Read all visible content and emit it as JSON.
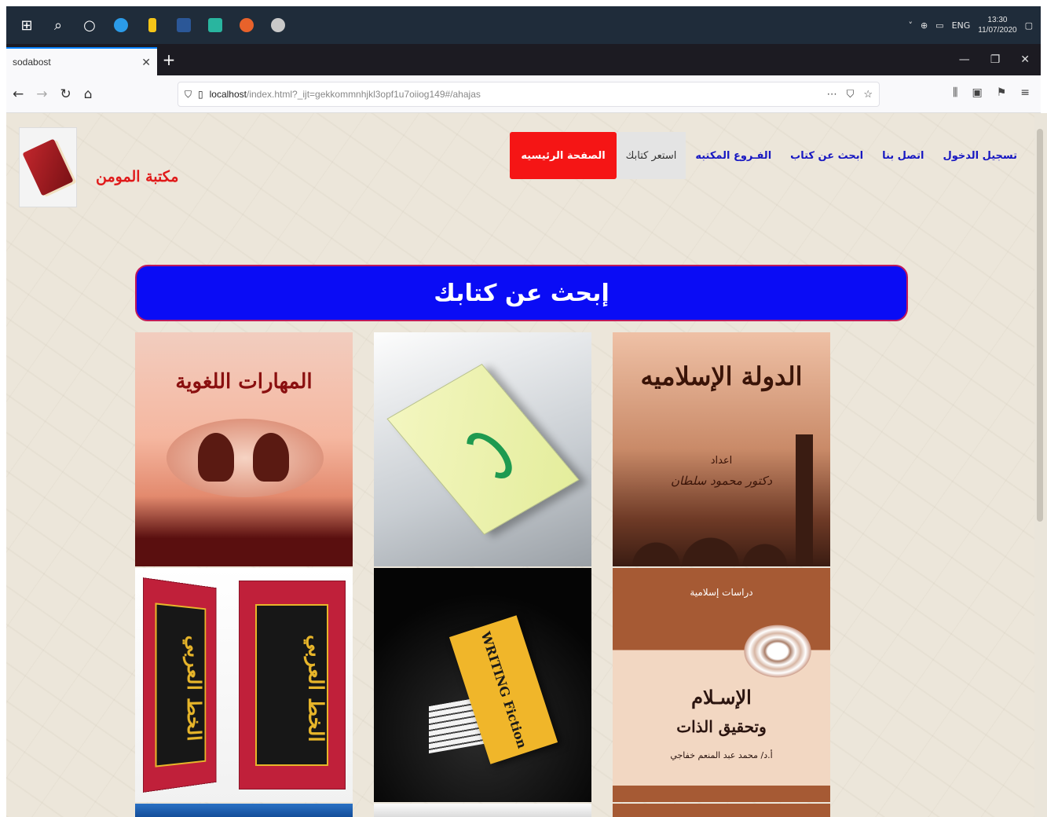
{
  "taskbar": {
    "icons": [
      "windows-start-icon",
      "search-icon",
      "cortana-icon",
      "edge-icon",
      "file-explorer-icon",
      "word-icon",
      "whatsapp-icon",
      "firefox-icon",
      "app-icon"
    ],
    "language": "ENG",
    "time": "13:30",
    "date": "11/07/2020"
  },
  "browser": {
    "tab_title": "sodabost",
    "url_host": "localhost",
    "url_rest": "/index.html?_ijt=gekkommnhjkl3opf1u7oiiog149#/ahajas"
  },
  "site": {
    "name": "مكتبة المومن",
    "menu": [
      {
        "label": "الصفحة الرئيسيه",
        "state": "active"
      },
      {
        "label": "استعر كتابك",
        "state": "borrow"
      },
      {
        "label": "الفـروع المكتبه",
        "state": "link"
      },
      {
        "label": "ابحث عن كتاب",
        "state": "link"
      },
      {
        "label": "اتصل بنا",
        "state": "link"
      },
      {
        "label": "تسجيل الدخول",
        "state": "link"
      }
    ],
    "search_banner": "إبحث عن كتابك"
  },
  "books": [
    {
      "title": "المهارات اللغوية"
    },
    {
      "title": ""
    },
    {
      "title": "الدولة الإسلاميه",
      "line1": "اعداد",
      "line2": "دكتور محمود سلطان"
    },
    {
      "title": "الخط العربي"
    },
    {
      "title": "WRITING Fiction"
    },
    {
      "top": "دراسات إسلامية",
      "title": "الإسـلام",
      "title2": "وتحقيق الذات",
      "author": "أ.د/ محمد عبد المنعم خفاجي"
    }
  ],
  "colors": {
    "banner": "#0a0cf5",
    "active_menu": "#f51515",
    "menu_link": "#1717c2",
    "site_name": "#e01a1a"
  }
}
